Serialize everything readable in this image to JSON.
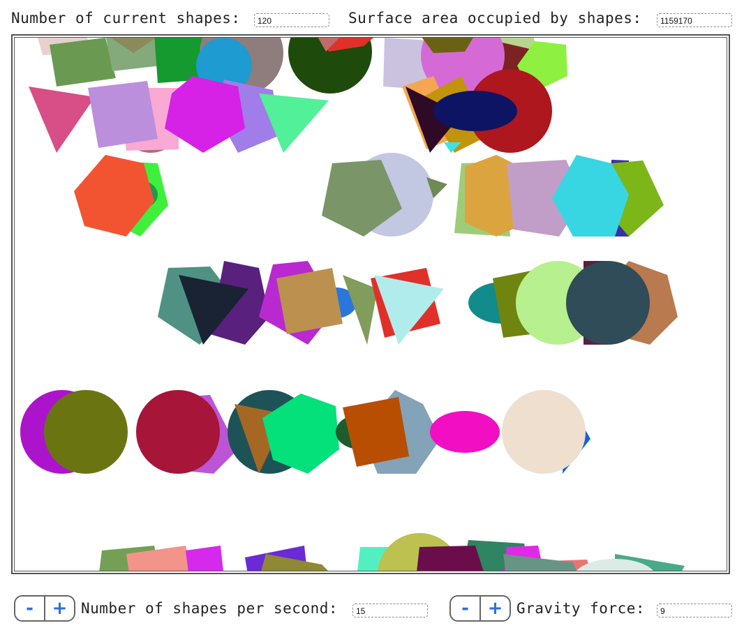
{
  "header": {
    "shapes_count_label": "Number of current shapes:",
    "shapes_count_value": "120",
    "surface_area_label": "Surface area occupied by shapes:",
    "surface_area_value": "1159170"
  },
  "controls": {
    "minus_label": "-",
    "plus_label": "+",
    "shapes_per_second_label": "Number of shapes per second:",
    "shapes_per_second_value": "15",
    "gravity_label": "Gravity force:",
    "gravity_value": "9"
  },
  "colors": {
    "accent": "#2b6fe0",
    "border": "#555555"
  }
}
